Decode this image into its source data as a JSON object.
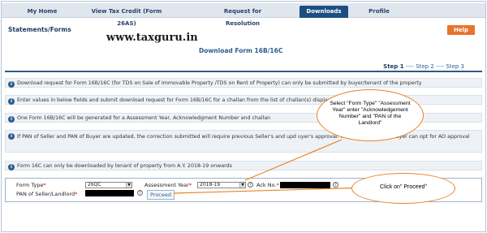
{
  "nav": {
    "tabs": [
      "My Home",
      "View Tax Credit (Form 26AS)",
      "Request for Resolution",
      "Downloads",
      "Profile"
    ],
    "active_tab": "Downloads"
  },
  "header": {
    "section_title": "Statements/Forms",
    "help_label": "Help",
    "watermark": "www.taxguru.in",
    "page_heading": "Download Form 16B/16C"
  },
  "steps": {
    "step1": "Step 1",
    "sep1": " ---- ",
    "step2": "Step 2",
    "sep2": " ---- ",
    "step3": "Step 3"
  },
  "info": [
    "Download request for Form 16B/16C (for TDS on Sale of Immovable Property /TDS on Rent of Property) can only be submitted by buyer/tenant of the property",
    "Enter values in below fields and submit download request for Form 16B/16C for a challan from the list of challan(s) display",
    "One Form 16B/16C will be generated for a Assessment Year, Acknowledgment Number and challan",
    "If PAN of Seller and PAN of Buyer are updated, the correction submitted will require previous Seller's and upd       uyer's approval. If Seller is unknown Buyer can opt for AO approval",
    "Form 16C can only be downloaded by tenant of property from A.Y. 2018-19 onwards"
  ],
  "form": {
    "form_type_label": "Form Type",
    "form_type_value": "26QC",
    "assessment_year_label": "Assessment Year",
    "assessment_year_value": "2018-19",
    "ack_no_label": "Ack No.",
    "pan_label": "PAN of Seller/Landlord",
    "required_mark": "*",
    "proceed_label": "Proceed",
    "help_glyph": "?",
    "info_glyph": "i",
    "dropdown_glyph": "▼"
  },
  "callouts": {
    "top": "Select \"Form Type\" \"Assessment Year\" enter \"Acknowledgement Number\" and \"PAN of the Landlord\"",
    "bottom": "Click on\" Proceed\""
  },
  "colors": {
    "nav_active": "#1d4d82",
    "help_button": "#e8742c",
    "callout_border": "#e88325",
    "heading_blue": "#2f5c8f"
  }
}
